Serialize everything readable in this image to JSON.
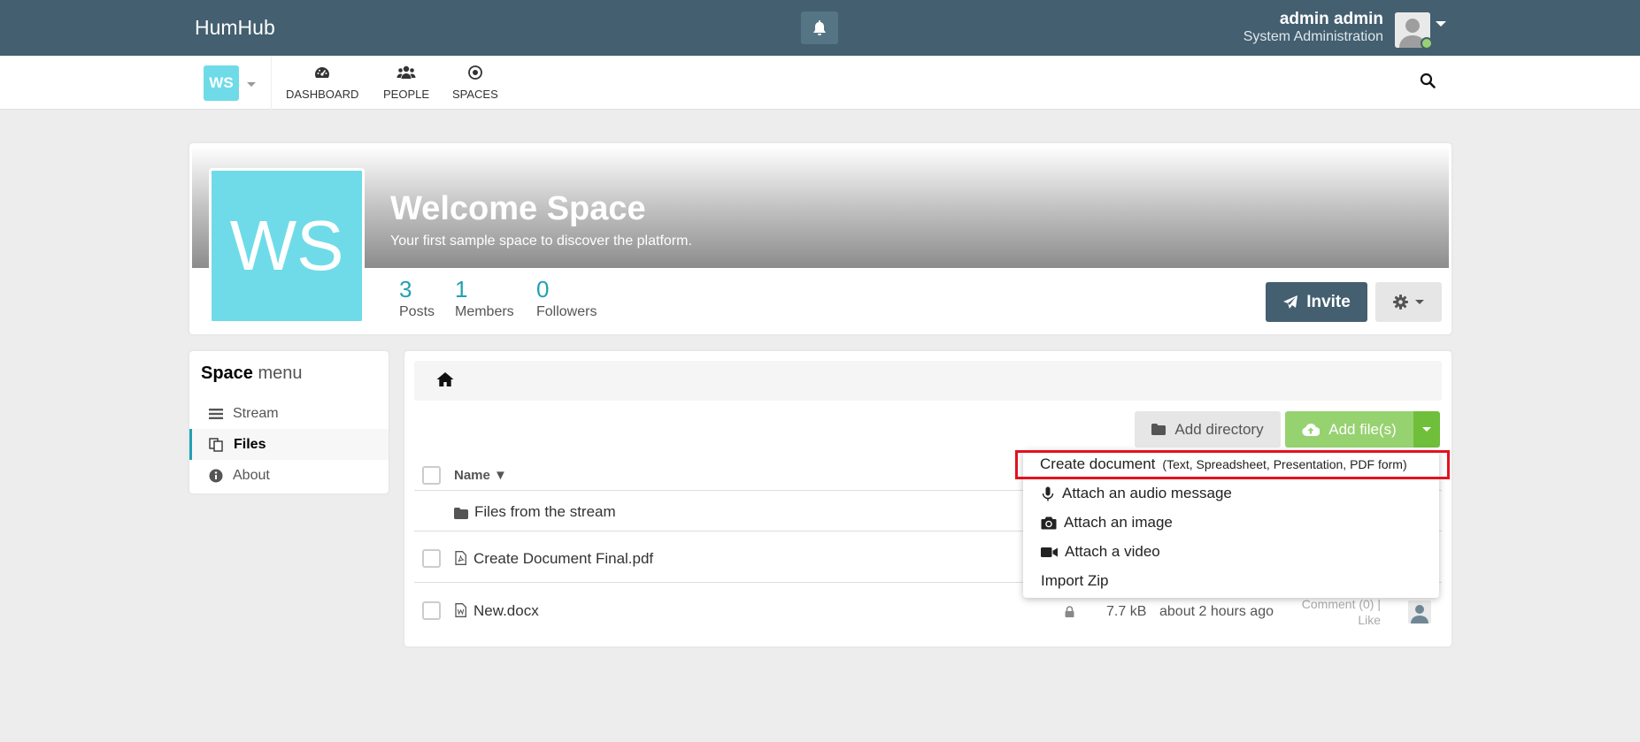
{
  "app": {
    "brand": "HumHub"
  },
  "user": {
    "name": "admin admin",
    "role": "System Administration"
  },
  "nav": {
    "space_chip": "WS",
    "items": [
      {
        "label": "DASHBOARD",
        "icon": "dashboard-icon"
      },
      {
        "label": "PEOPLE",
        "icon": "people-icon"
      },
      {
        "label": "SPACES",
        "icon": "spaces-icon"
      }
    ]
  },
  "space": {
    "logo_text": "WS",
    "title": "Welcome Space",
    "description": "Your first sample space to discover the platform.",
    "stats": [
      {
        "value": "3",
        "label": "Posts"
      },
      {
        "value": "1",
        "label": "Members"
      },
      {
        "value": "0",
        "label": "Followers"
      }
    ],
    "invite_label": "Invite"
  },
  "space_menu": {
    "title_bold": "Space",
    "title_light": "menu",
    "items": [
      {
        "label": "Stream",
        "icon": "stream-icon",
        "active": false
      },
      {
        "label": "Files",
        "icon": "files-icon",
        "active": true
      },
      {
        "label": "About",
        "icon": "info-icon",
        "active": false
      }
    ]
  },
  "files": {
    "add_directory_label": "Add directory",
    "add_files_label": "Add file(s)",
    "column_name": "Name ▼",
    "rows": [
      {
        "name": "Files from the stream",
        "icon": "folder-icon"
      },
      {
        "name": "Create Document Final.pdf",
        "icon": "pdf-file-icon"
      },
      {
        "name": "New.docx",
        "icon": "word-file-icon",
        "size": "7.7 kB",
        "time": "about 2 hours ago",
        "comment": "Comment (0)  |",
        "like": "Like"
      }
    ]
  },
  "dropdown": {
    "create_document": "Create document",
    "create_document_sub": "(Text, Spreadsheet, Presentation, PDF form)",
    "audio": "Attach an audio message",
    "image": "Attach an image",
    "video": "Attach a video",
    "import_zip": "Import Zip"
  },
  "colors": {
    "topbar": "#435f70",
    "accent": "#21a1b3",
    "space_color": "#6fdbe8",
    "success": "#97d271",
    "highlight": "#e2121e"
  }
}
